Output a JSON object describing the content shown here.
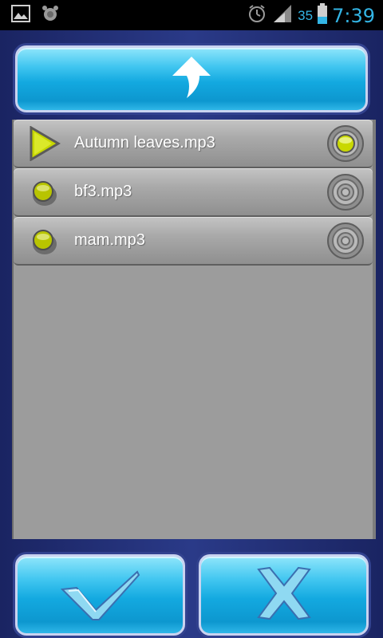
{
  "status": {
    "battery": "35",
    "time": "7:39"
  },
  "files": [
    {
      "name": "Autumn leaves.mp3",
      "state": "playing",
      "selected": true
    },
    {
      "name": "bf3.mp3",
      "state": "idle",
      "selected": false
    },
    {
      "name": "mam.mp3",
      "state": "idle",
      "selected": false
    }
  ],
  "colors": {
    "accent_cyan": "#13a9e0",
    "frame_navy": "#1c2766",
    "status_blue": "#33b5e5",
    "indicator_green": "#c9d800"
  },
  "icons": {
    "up": "up-arrow-icon",
    "ok": "checkmark-icon",
    "cancel": "x-icon"
  }
}
